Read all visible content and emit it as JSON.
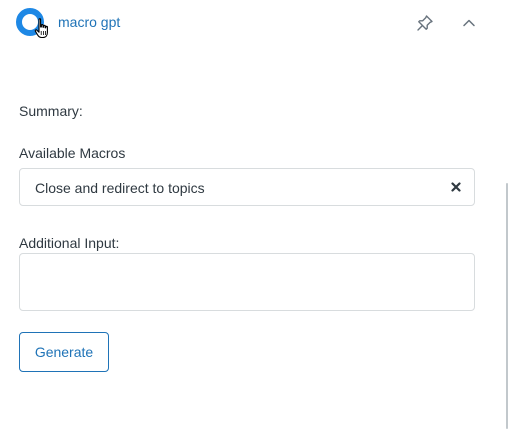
{
  "header": {
    "app_title": "macro gpt",
    "logo_icon": "app-logo-icon",
    "cursor_icon": "hand-pointer-icon",
    "pin_icon": "pin-icon",
    "collapse_icon": "chevron-up-icon"
  },
  "form": {
    "summary_label": "Summary:",
    "macros_label": "Available Macros",
    "selected_macro": "Close and redirect to topics",
    "clear_icon": "clear-x-icon",
    "additional_input_label": "Additional Input:",
    "additional_input_value": "",
    "generate_label": "Generate"
  },
  "colors": {
    "accent": "#1f73b7",
    "logo_blue": "#1e88e5",
    "text": "#2f3941",
    "border": "#d8dcde"
  }
}
